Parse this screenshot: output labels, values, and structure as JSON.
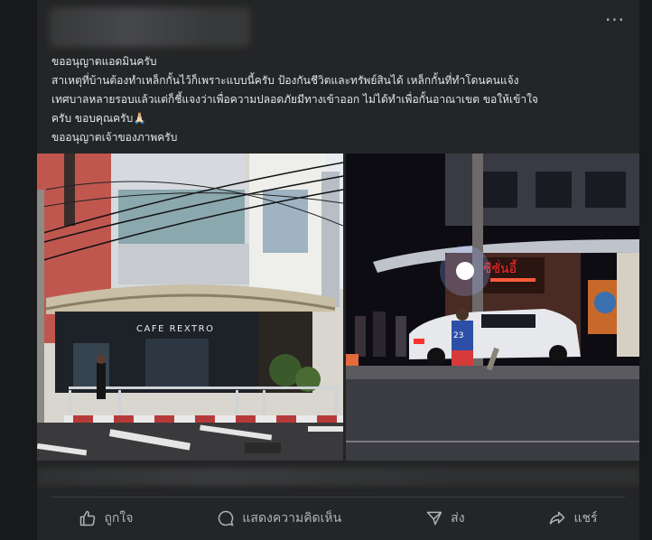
{
  "post": {
    "more_label": "···",
    "text_lines": [
      "ขออนุญาตแอดมินครับ",
      "สาเหตุที่บ้านต้องทำเหล็กกั้นไว้ก็เพราะแบบนี้ครับ ป้องกันชีวิตและทรัพย์สินได้ เหล็กกั้นที่ทำโดนคนแจ้ง",
      "เทศบาลหลายรอบแล้วแต่ก็ชี้แจงว่าเพื่อความปลอดภัยมีทางเข้าออก ไม่ได้ทำเพื่อกั้นอาณาเขต ขอให้เข้าใจ",
      "ครับ ขอบคุณครับ🙏🏻",
      "ขออนุญาตเจ้าของภาพครับ"
    ],
    "photos": {
      "left": {
        "sign_text": "CAFE REXTRO"
      },
      "right": {
        "shop_sign_text": "ซีซั่นอี้",
        "jersey_number": "23"
      }
    }
  },
  "actions": {
    "like_label": "ถูกใจ",
    "comment_label": "แสดงความคิดเห็น",
    "send_label": "ส่ง",
    "share_label": "แชร์"
  },
  "icons": {
    "like": "thumbs-up-icon",
    "comment": "comment-bubble-icon",
    "send": "send-icon",
    "share": "share-arrow-icon",
    "more": "more-dots-icon"
  },
  "colors": {
    "background": "#18191a",
    "card": "#242526",
    "text": "#e4e6eb",
    "secondary": "#b0b3b8"
  }
}
